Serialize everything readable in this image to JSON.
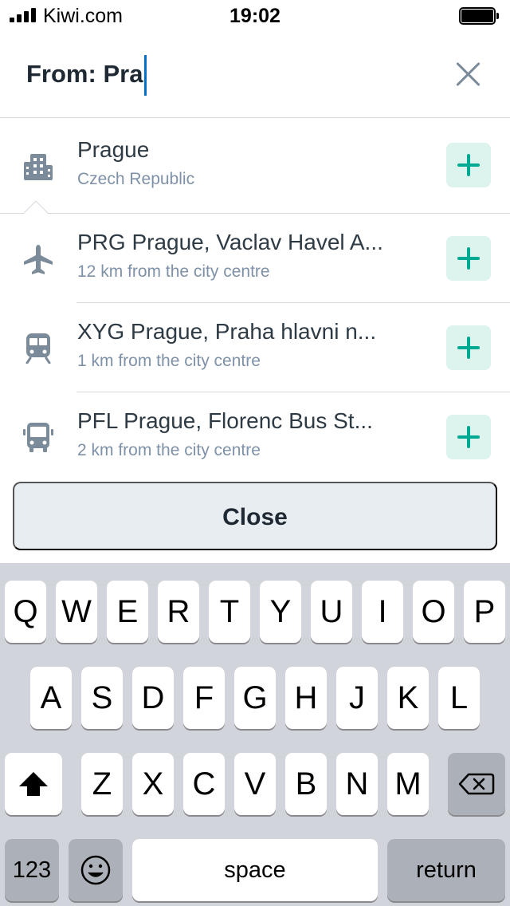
{
  "status_bar": {
    "carrier": "Kiwi.com",
    "time": "19:02"
  },
  "search": {
    "prefix": "From:",
    "query": "Pra"
  },
  "results": [
    {
      "icon": "city-icon",
      "title": "Prague",
      "subtitle": "Czech Republic"
    },
    {
      "icon": "airplane-icon",
      "title": "PRG Prague, Vaclav Havel A...",
      "subtitle": "12 km from the city centre"
    },
    {
      "icon": "train-icon",
      "title": "XYG Prague, Praha hlavni n...",
      "subtitle": "1 km from the city centre"
    },
    {
      "icon": "bus-icon",
      "title": "PFL Prague, Florenc Bus St...",
      "subtitle": "2 km from the city centre"
    }
  ],
  "close_label": "Close",
  "keyboard": {
    "row1": [
      "Q",
      "W",
      "E",
      "R",
      "T",
      "Y",
      "U",
      "I",
      "O",
      "P"
    ],
    "row2": [
      "A",
      "S",
      "D",
      "F",
      "G",
      "H",
      "J",
      "K",
      "L"
    ],
    "row3": [
      "Z",
      "X",
      "C",
      "V",
      "B",
      "N",
      "M"
    ],
    "numbers_label": "123",
    "space_label": "space",
    "return_label": "return"
  },
  "colors": {
    "accent": "#00a991",
    "caret": "#0172cb",
    "icon": "#7c8b99",
    "subtitle": "#7f91a8"
  }
}
